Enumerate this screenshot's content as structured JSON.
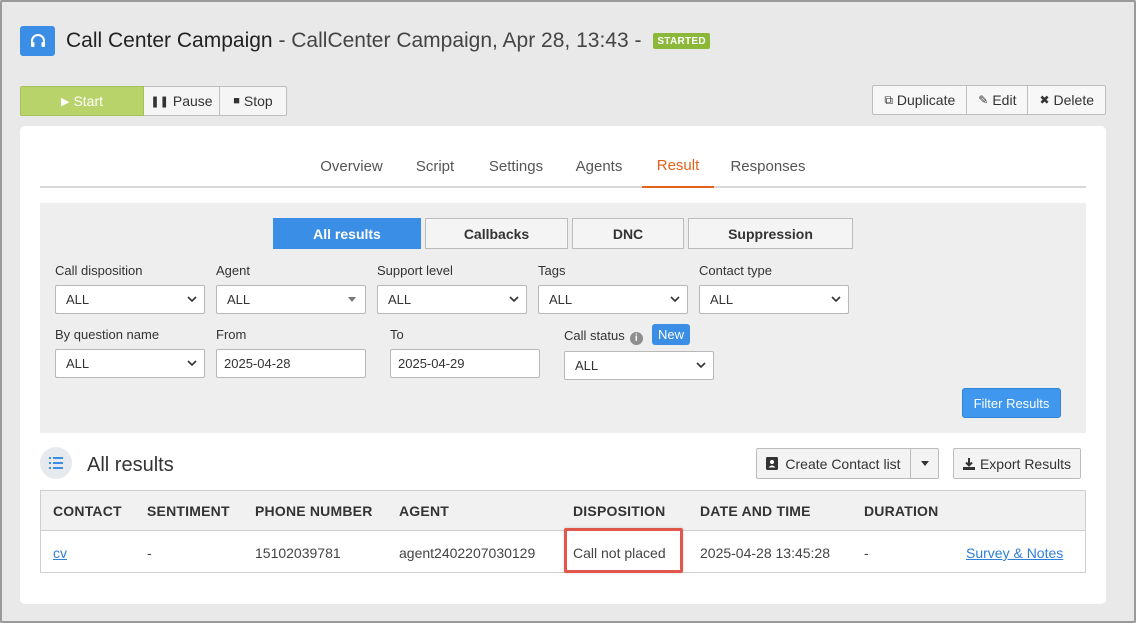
{
  "header": {
    "campaign_name": "Call Center Campaign",
    "campaign_detail": " - CallCenter Campaign, Apr 28, 13:43 - ",
    "status_badge": "STARTED",
    "icon": "headset-icon"
  },
  "controls": {
    "start": "Start",
    "pause": "Pause",
    "stop": "Stop"
  },
  "actions": {
    "duplicate": "Duplicate",
    "edit": "Edit",
    "delete": "Delete"
  },
  "tabs": [
    {
      "label": "Overview"
    },
    {
      "label": "Script"
    },
    {
      "label": "Settings"
    },
    {
      "label": "Agents"
    },
    {
      "label": "Result"
    },
    {
      "label": "Responses"
    }
  ],
  "active_tab": "Result",
  "result_types": [
    {
      "label": "All results"
    },
    {
      "label": "Callbacks"
    },
    {
      "label": "DNC"
    },
    {
      "label": "Suppression"
    }
  ],
  "filters": {
    "call_disposition": {
      "label": "Call disposition",
      "value": "ALL"
    },
    "agent": {
      "label": "Agent",
      "value": "ALL"
    },
    "support_level": {
      "label": "Support level",
      "value": "ALL"
    },
    "tags": {
      "label": "Tags",
      "value": "ALL"
    },
    "contact_type": {
      "label": "Contact type",
      "value": "ALL"
    },
    "by_question_name": {
      "label": "By question name",
      "value": "ALL"
    },
    "from": {
      "label": "From",
      "value": "2025-04-28"
    },
    "to": {
      "label": "To",
      "value": "2025-04-29"
    },
    "call_status": {
      "label": "Call status",
      "value": "ALL",
      "badge": "New"
    },
    "submit": "Filter Results"
  },
  "results": {
    "title": "All results",
    "create_contact_list": "Create Contact list",
    "export": "Export Results",
    "columns": [
      "CONTACT",
      "SENTIMENT",
      "PHONE NUMBER",
      "AGENT",
      "DISPOSITION",
      "DATE AND TIME",
      "DURATION"
    ],
    "rows": [
      {
        "contact": "cv",
        "sentiment": "-",
        "phone": "15102039781",
        "agent": "agent2402207030129",
        "disposition": "Call not placed",
        "datetime": "2025-04-28 13:45:28",
        "duration": "-",
        "action": "Survey & Notes"
      }
    ]
  },
  "colors": {
    "accent": "#3a8ee6",
    "active_tab": "#e2621b",
    "started_badge": "#8cb83a",
    "highlight": "#e2574c"
  }
}
